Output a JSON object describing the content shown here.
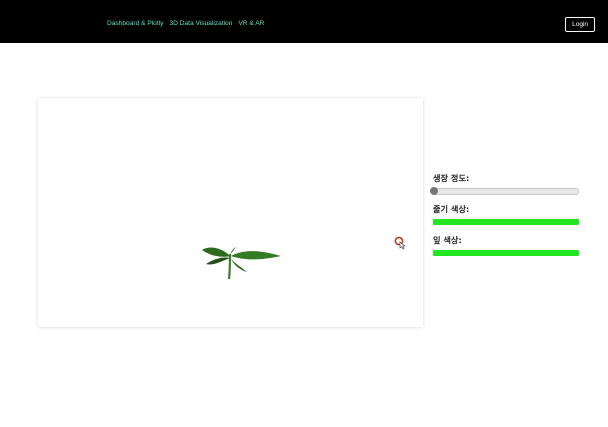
{
  "nav": {
    "links": [
      "Dashboard & Plotly",
      "3D Data Visualization",
      "VR & AR"
    ],
    "login_label": "Login"
  },
  "controls": {
    "growth_label": "생장 정도:",
    "growth_value": 0,
    "stem_color_label": "줄기 색상:",
    "stem_color": "#22e622",
    "leaf_color_label": "잎 색상:",
    "leaf_color": "#22e622"
  },
  "icons": {
    "cursor": "hand-pointer-icon"
  }
}
